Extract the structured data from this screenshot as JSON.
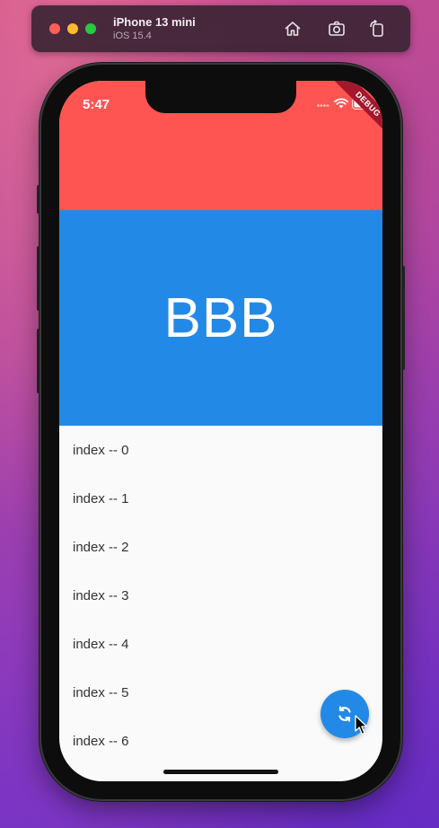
{
  "simulator": {
    "device_name": "iPhone 13 mini",
    "os_version": "iOS 15.4",
    "toolbar_icons": [
      "home-icon",
      "screenshot-icon",
      "rotate-icon"
    ]
  },
  "status_bar": {
    "time": "5:47",
    "icons": [
      "cellular-icon",
      "wifi-icon",
      "battery-icon"
    ]
  },
  "debug_banner": {
    "label": "DEBUG"
  },
  "app": {
    "colors": {
      "top_bar": "#fe5552",
      "hero": "#2389e7",
      "background": "#fafafa",
      "fab": "#2389e7"
    },
    "hero_title": "BBB",
    "list_items": [
      "index -- 0",
      "index -- 1",
      "index -- 2",
      "index -- 3",
      "index -- 4",
      "index -- 5",
      "index -- 6"
    ],
    "fab_icon": "refresh-icon"
  }
}
